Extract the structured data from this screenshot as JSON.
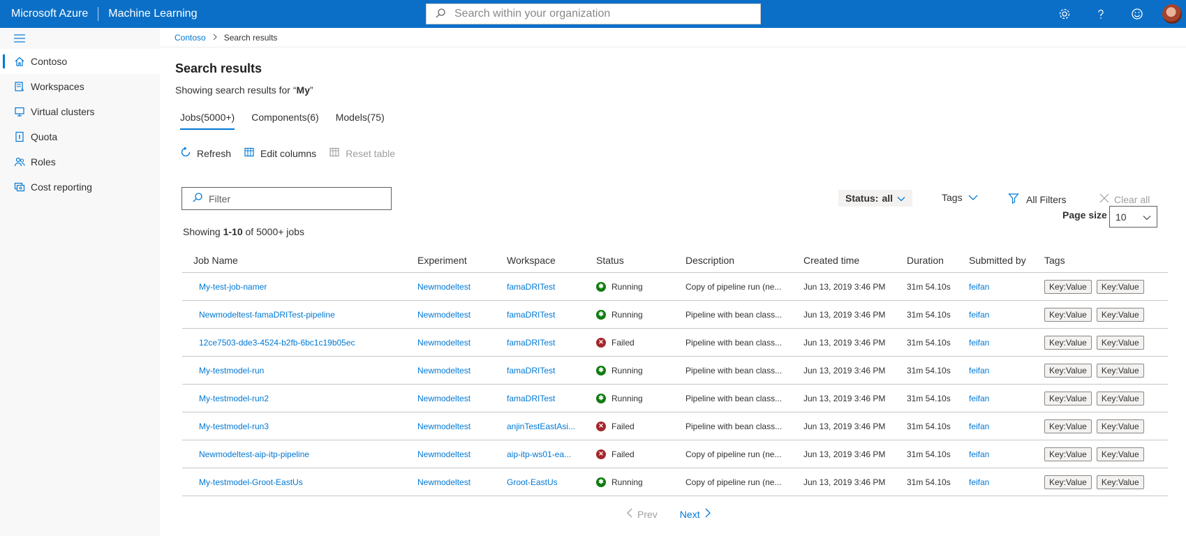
{
  "header": {
    "brand": "Microsoft Azure",
    "product": "Machine Learning",
    "search_placeholder": "Search within your organization"
  },
  "sidebar": {
    "items": [
      {
        "label": "Contoso",
        "icon": "home-icon",
        "active": true
      },
      {
        "label": "Workspaces",
        "icon": "workspaces-icon"
      },
      {
        "label": "Virtual clusters",
        "icon": "monitor-icon"
      },
      {
        "label": "Quota",
        "icon": "quota-icon"
      },
      {
        "label": "Roles",
        "icon": "people-icon"
      },
      {
        "label": "Cost reporting",
        "icon": "cost-icon"
      }
    ]
  },
  "breadcrumb": {
    "root": "Contoso",
    "current": "Search results"
  },
  "page": {
    "title": "Search results",
    "subtitle_prefix": "Showing search results for “",
    "query": "My",
    "subtitle_suffix": "”"
  },
  "tabs": [
    {
      "label": "Jobs(5000+)",
      "active": true
    },
    {
      "label": "Components(6)"
    },
    {
      "label": "Models(75)"
    }
  ],
  "toolbar": {
    "refresh": "Refresh",
    "edit_columns": "Edit columns",
    "reset_table": "Reset table"
  },
  "filters": {
    "filter_placeholder": "Filter",
    "status_label": "Status:",
    "status_value": "all",
    "tags": "Tags",
    "all_filters": "All Filters",
    "clear_all": "Clear all",
    "page_size_label": "Page size",
    "page_size_value": "10"
  },
  "summary": {
    "prefix": "Showing ",
    "range": "1-10",
    "suffix": " of 5000+ jobs"
  },
  "table": {
    "columns": [
      "Job Name",
      "Experiment",
      "Workspace",
      "Status",
      "Description",
      "Created time",
      "Duration",
      "Submitted by",
      "Tags"
    ],
    "rows": [
      {
        "name": "My-test-job-namer",
        "experiment": "Newmodeltest",
        "workspace": "famaDRITest",
        "status": "Running",
        "description": "Copy of pipeline run (ne...",
        "created": "Jun 13, 2019 3:46 PM",
        "duration": "31m 54.10s",
        "submitted_by": "feifan",
        "tags": [
          "Key:Value",
          "Key:Value"
        ]
      },
      {
        "name": "Newmodeltest-famaDRITest-pipeline",
        "experiment": "Newmodeltest",
        "workspace": "famaDRITest",
        "status": "Running",
        "description": "Pipeline with bean class...",
        "created": "Jun 13, 2019 3:46 PM",
        "duration": "31m 54.10s",
        "submitted_by": "feifan",
        "tags": [
          "Key:Value",
          "Key:Value"
        ]
      },
      {
        "name": "12ce7503-dde3-4524-b2fb-6bc1c19b05ec",
        "experiment": "Newmodeltest",
        "workspace": "famaDRITest",
        "status": "Failed",
        "description": "Pipeline with bean class...",
        "created": "Jun 13, 2019 3:46 PM",
        "duration": "31m 54.10s",
        "submitted_by": "feifan",
        "tags": [
          "Key:Value",
          "Key:Value"
        ]
      },
      {
        "name": "My-testmodel-run",
        "experiment": "Newmodeltest",
        "workspace": "famaDRITest",
        "status": "Running",
        "description": "Pipeline with bean class...",
        "created": "Jun 13, 2019 3:46 PM",
        "duration": "31m 54.10s",
        "submitted_by": "feifan",
        "tags": [
          "Key:Value",
          "Key:Value"
        ]
      },
      {
        "name": "My-testmodel-run2",
        "experiment": "Newmodeltest",
        "workspace": "famaDRITest",
        "status": "Running",
        "description": "Pipeline with bean class...",
        "created": "Jun 13, 2019 3:46 PM",
        "duration": "31m 54.10s",
        "submitted_by": "feifan",
        "tags": [
          "Key:Value",
          "Key:Value"
        ]
      },
      {
        "name": "My-testmodel-run3",
        "experiment": "Newmodeltest",
        "workspace": "anjinTestEastAsi...",
        "status": "Failed",
        "description": "Pipeline with bean class...",
        "created": "Jun 13, 2019 3:46 PM",
        "duration": "31m 54.10s",
        "submitted_by": "feifan",
        "tags": [
          "Key:Value",
          "Key:Value"
        ]
      },
      {
        "name": "Newmodeltest-aip-itp-pipeline",
        "experiment": "Newmodeltest",
        "workspace": "aip-itp-ws01-ea...",
        "status": "Failed",
        "description": "Copy of pipeline run (ne...",
        "created": "Jun 13, 2019 3:46 PM",
        "duration": "31m 54.10s",
        "submitted_by": "feifan",
        "tags": [
          "Key:Value",
          "Key:Value"
        ]
      },
      {
        "name": "My-testmodel-Groot-EastUs",
        "experiment": "Newmodeltest",
        "workspace": "Groot-EastUs",
        "status": "Running",
        "description": "Copy of pipeline run (ne...",
        "created": "Jun 13, 2019 3:46 PM",
        "duration": "31m 54.10s",
        "submitted_by": "feifan",
        "tags": [
          "Key:Value",
          "Key:Value"
        ]
      }
    ]
  },
  "pager": {
    "prev": "Prev",
    "next": "Next"
  },
  "colors": {
    "header_bg": "#0b6fc7",
    "accent": "#0078d4",
    "running": "#107c10",
    "failed": "#a4262c"
  }
}
